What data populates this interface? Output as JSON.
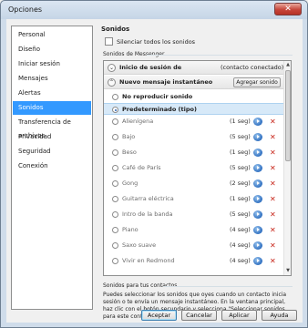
{
  "window": {
    "title": "Opciones",
    "close_glyph": "✕"
  },
  "sidebar": {
    "items": [
      {
        "label": "Personal"
      },
      {
        "label": "Diseño"
      },
      {
        "label": "Iniciar sesión"
      },
      {
        "label": "Mensajes"
      },
      {
        "label": "Alertas"
      },
      {
        "label": "Sonidos",
        "selected": true
      },
      {
        "label": "Transferencia de archivos"
      },
      {
        "label": "Privacidad"
      },
      {
        "label": "Seguridad"
      },
      {
        "label": "Conexión"
      }
    ]
  },
  "sounds": {
    "title": "Sonidos",
    "mute_all_label": "Silenciar todos los sonidos",
    "mute_all_checked": false,
    "messenger_group_label": "Sonidos de Messenger",
    "event_signin": {
      "label": "Inicio de sesión de",
      "status": "(contacto conectado)",
      "icon": "collapse-chevron-icon",
      "glyph": "⌄"
    },
    "event_message": {
      "label": "Nuevo mensaje instantáneo",
      "icon": "collapse-chevron-icon",
      "glyph": "⌃",
      "add_button": "Agregar sonido"
    },
    "options": [
      {
        "label": "No reproducir sonido",
        "bold": true,
        "checked": false
      },
      {
        "label": "Predeterminado (tipo)",
        "bold": true,
        "checked": true,
        "selected": true
      }
    ],
    "sound_items": [
      {
        "label": "Alienígena",
        "duration": "(1 seg)"
      },
      {
        "label": "Bajo",
        "duration": "(5 seg)"
      },
      {
        "label": "Beso",
        "duration": "(1 seg)"
      },
      {
        "label": "Café de París",
        "duration": "(5 seg)"
      },
      {
        "label": "Gong",
        "duration": "(2 seg)"
      },
      {
        "label": "Guitarra eléctrica",
        "duration": "(1 seg)"
      },
      {
        "label": "Intro de la banda",
        "duration": "(5 seg)"
      },
      {
        "label": "Piano",
        "duration": "(4 seg)"
      },
      {
        "label": "Saxo suave",
        "duration": "(4 seg)"
      },
      {
        "label": "Vivir en Redmond",
        "duration": "(4 seg)"
      }
    ],
    "delete_glyph": "✕",
    "scroll_up": "▲",
    "scroll_down": "▼",
    "contacts_group_label": "Sonidos para tus contactos",
    "contacts_info": "Puedes seleccionar los sonidos que oyes cuando un contacto inicia sesión o te envía un mensaje instantáneo. En la ventana principal, haz clic con el botón secundario y selecciona \"Seleccionar sonidos para este contacto\"."
  },
  "footer": {
    "ok": "Aceptar",
    "cancel": "Cancelar",
    "apply": "Aplicar",
    "help": "Ayuda"
  },
  "colors": {
    "selection": "#3399ff",
    "delete": "#c8281d",
    "play": "#2f6fc0"
  }
}
